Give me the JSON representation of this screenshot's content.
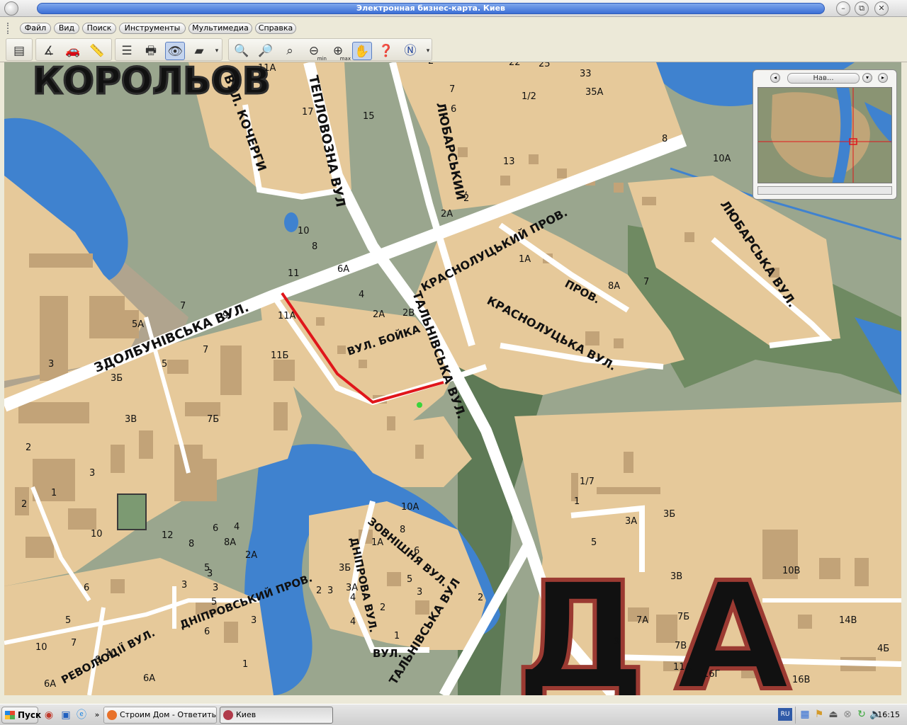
{
  "window": {
    "title": "Электронная бизнес-карта. Киев"
  },
  "menu": {
    "items": [
      "Файл",
      "Вид",
      "Поиск",
      "Инструменты",
      "Мультимедиа",
      "Справка"
    ]
  },
  "toolbar": {
    "zoom_min_label": "min",
    "zoom_max_label": "max"
  },
  "overview": {
    "title": "Нав..."
  },
  "map": {
    "district_label": "КОРОЛЬОВ",
    "district_label_2": "ДА",
    "streets": {
      "zdolbunivska": "ЗДОЛБУНІВСЬКА ВУЛ.",
      "teplovozna": "ТЕПЛОВОЗНА ВУЛ",
      "lyubarskyi": "ЛЮБАРСЬКИЙ",
      "krasnolutskyi": "КРАСНОЛУЦЬКИЙ ПРОВ.",
      "krasnolutska": "КРАСНОЛУЦЬКА ВУЛ.",
      "lyubarska": "ЛЮБАРСЬКА ВУЛ.",
      "talnivska": "ТАЛЬНІВСЬКА ВУЛ.",
      "talnivska_2": "ТАЛЬНІВСЬКА ВУЛ",
      "bojka": "ВУЛ. БОЙКА",
      "kocherhy": "ВУЛ. КОЧЕРГИ",
      "zovnishnia": "ЗОВНІШНЯ ВУЛ.",
      "dniprova": "ДНІПРОВА ВУЛ.",
      "dniprovsky": "ДНІПРОВСЬКИЙ ПРОВ.",
      "revolutsii": "РЕВОЛЮЦІЇ ВУЛ.",
      "prov": "ПРОВ.",
      "vul": "ВУЛ."
    },
    "house_numbers": [
      "23А",
      "23",
      "22",
      "25",
      "33",
      "35А",
      "2",
      "7",
      "6",
      "1/2",
      "11Б",
      "11А",
      "17",
      "15",
      "12",
      "9",
      "13",
      "8",
      "10А",
      "2А",
      "2",
      "1А",
      "8А",
      "7",
      "10",
      "8",
      "6А",
      "4",
      "2А",
      "2В",
      "11",
      "11А",
      "11Б",
      "9",
      "7",
      "7",
      "5А",
      "3Б",
      "5",
      "3",
      "2",
      "3В",
      "7Б",
      "3",
      "1",
      "3",
      "5",
      "2",
      "4",
      "10",
      "12",
      "6",
      "4",
      "8",
      "8А",
      "2А",
      "3",
      "3",
      "5",
      "6",
      "10",
      "6А",
      "5",
      "7",
      "8",
      "10А",
      "8",
      "6",
      "1А",
      "3Б",
      "3А",
      "3",
      "5",
      "3",
      "2",
      "4",
      "1",
      "2",
      "1/7",
      "1",
      "3А",
      "3Б",
      "5",
      "3В",
      "10В",
      "7Б",
      "7А",
      "9",
      "7В",
      "11А",
      "16Г",
      "16В",
      "14В",
      "4Б",
      "1",
      "2",
      "6",
      "3",
      "6А",
      "10"
    ]
  },
  "taskbar": {
    "start_label": "Пуск",
    "tasks": [
      "Строим Дом - Ответить...",
      "Киев"
    ],
    "language": "RU",
    "clock": "16:15"
  },
  "colors": {
    "water": "#3f82cf",
    "built": "#e6c99a",
    "road": "#ffffff",
    "green": "#9aa68e",
    "dark_green": "#5e7a56",
    "route": "#e0161b",
    "district_label": "#9b3a32"
  }
}
